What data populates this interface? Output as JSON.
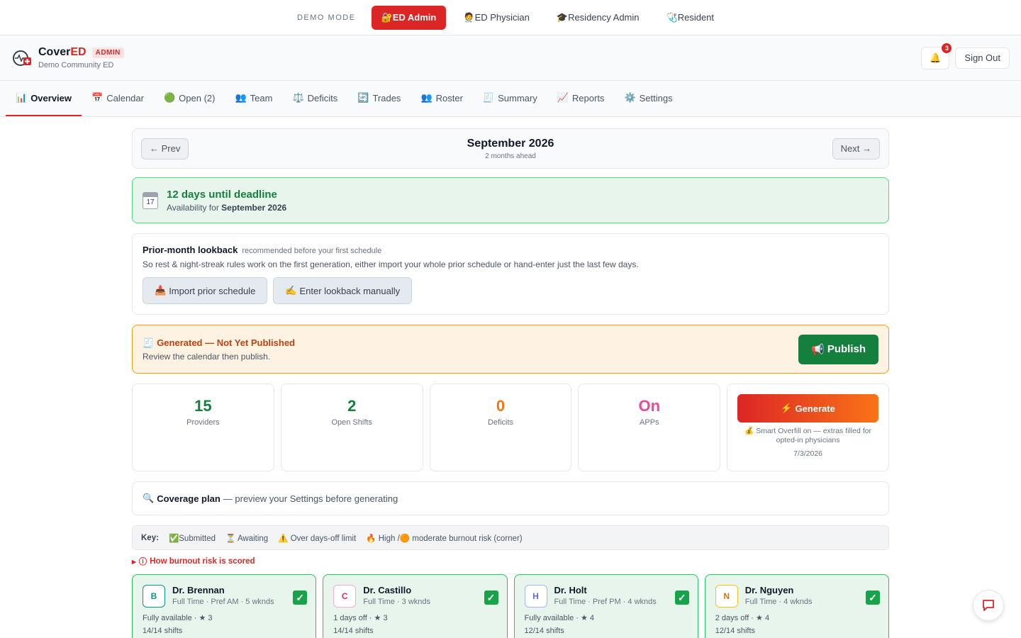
{
  "demo": {
    "label": "DEMO MODE",
    "roles": [
      {
        "icon": "🔐",
        "label": "ED Admin"
      },
      {
        "icon": "🧑‍⚕️",
        "label": "ED Physician"
      },
      {
        "icon": "🎓",
        "label": "Residency Admin"
      },
      {
        "icon": "🩺",
        "label": "Resident"
      }
    ]
  },
  "header": {
    "brand_a": "Cover",
    "brand_b": "ED",
    "badge": "ADMIN",
    "subtitle": "Demo Community ED",
    "notif_count": "3",
    "signout": "Sign Out"
  },
  "nav": {
    "tabs": [
      {
        "icon": "📊",
        "label": "Overview"
      },
      {
        "icon": "📅",
        "label": "Calendar"
      },
      {
        "icon": "🟢",
        "label": "Open (2)"
      },
      {
        "icon": "👥",
        "label": "Team"
      },
      {
        "icon": "⚖️",
        "label": "Deficits"
      },
      {
        "icon": "🔄",
        "label": "Trades"
      },
      {
        "icon": "👥",
        "label": "Roster"
      },
      {
        "icon": "🧾",
        "label": "Summary"
      },
      {
        "icon": "📈",
        "label": "Reports"
      },
      {
        "icon": "⚙️",
        "label": "Settings"
      }
    ]
  },
  "month": {
    "prev": "← Prev",
    "next": "Next →",
    "title": "September 2026",
    "sub": "2 months ahead"
  },
  "deadline": {
    "day": "17",
    "title": "12 days until deadline",
    "sub_prefix": "Availability for ",
    "sub_month": "September 2026"
  },
  "lookback": {
    "title": "Prior-month lookback",
    "rec": "recommended before your first schedule",
    "desc": "So rest & night-streak rules work on the first generation, either import your whole prior schedule or hand-enter just the last few days.",
    "import": "Import prior schedule",
    "manual": "Enter lookback manually"
  },
  "generated": {
    "title": "Generated — Not Yet Published",
    "sub": "Review the calendar then publish.",
    "publish": "Publish"
  },
  "stats": [
    {
      "value": "15",
      "label": "Providers",
      "color": "#15803d"
    },
    {
      "value": "2",
      "label": "Open Shifts",
      "color": "#15803d"
    },
    {
      "value": "0",
      "label": "Deficits",
      "color": "#f97316"
    },
    {
      "value": "On",
      "label": "APPs",
      "color": "#ec4899"
    }
  ],
  "generate": {
    "label": "Generate",
    "note": "Smart Overfill on — extras filled for opted-in physicians",
    "date": "7/3/2026"
  },
  "coverage": {
    "title": "Coverage plan",
    "desc": "— preview your Settings before generating"
  },
  "key": {
    "label": "Key:",
    "items": [
      "Submitted",
      "Awaiting",
      "Over days-off limit",
      "High /",
      "moderate burnout risk (corner)"
    ]
  },
  "burnout_link": "How burnout risk is scored",
  "providers": [
    {
      "initial": "B",
      "name": "Dr. Brennan",
      "meta": "Full Time · Pref AM · 5 wknds",
      "avail": "Fully available",
      "stars": "3",
      "shifts": "14/14 shifts",
      "color": "#0d9488"
    },
    {
      "initial": "C",
      "name": "Dr. Castillo",
      "meta": "Full Time · 3 wknds",
      "avail": "1 days off",
      "stars": "3",
      "shifts": "14/14 shifts",
      "color": "#db2777"
    },
    {
      "initial": "H",
      "name": "Dr. Holt",
      "meta": "Full Time · Pref PM · 4 wknds",
      "avail": "Fully available",
      "stars": "4",
      "shifts": "12/14 shifts",
      "color": "#6366f1"
    },
    {
      "initial": "N",
      "name": "Dr. Nguyen",
      "meta": "Full Time · 4 wknds",
      "avail": "2 days off",
      "stars": "4",
      "shifts": "12/14 shifts",
      "color": "#d97706"
    }
  ]
}
